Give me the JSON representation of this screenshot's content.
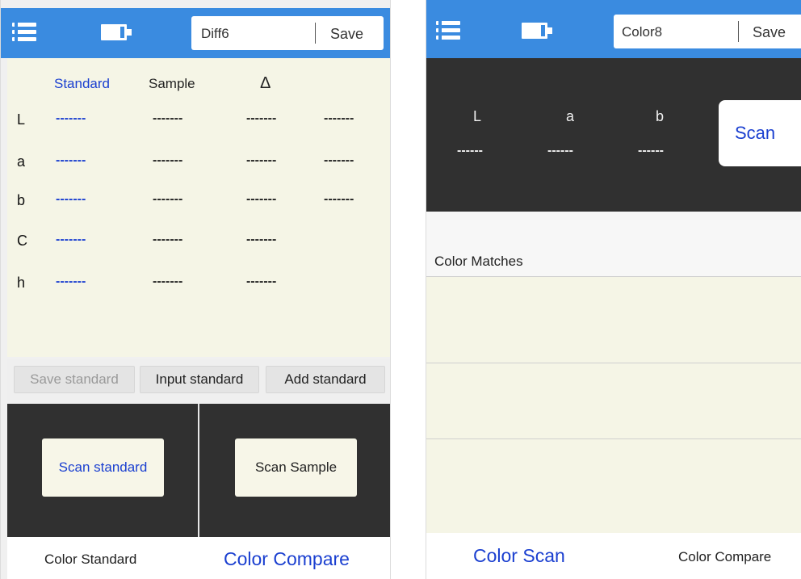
{
  "colors": {
    "header": "#3a8be0",
    "accent_blue": "#1a3fd0",
    "dark_panel": "#303030",
    "cream": "#f5f5e6"
  },
  "left_screen": {
    "header": {
      "menu_icon": "menu-icon",
      "battery_icon": "battery-icon",
      "name": "Diff6",
      "save_label": "Save"
    },
    "table": {
      "columns": [
        "Standard",
        "Sample",
        "Δ"
      ],
      "rows": [
        {
          "label": "L",
          "values": [
            "-------",
            "-------",
            "-------",
            "-------"
          ]
        },
        {
          "label": "a",
          "values": [
            "-------",
            "-------",
            "-------",
            "-------"
          ]
        },
        {
          "label": "b",
          "values": [
            "-------",
            "-------",
            "-------",
            "-------"
          ]
        },
        {
          "label": "C",
          "values": [
            "-------",
            "-------",
            "-------"
          ]
        },
        {
          "label": "h",
          "values": [
            "-------",
            "-------",
            "-------"
          ]
        }
      ]
    },
    "buttons": {
      "save_standard": "Save standard",
      "input_standard": "Input standard",
      "add_standard": "Add standard"
    },
    "scan": {
      "scan_standard": "Scan standard",
      "scan_sample": "Scan Sample"
    },
    "tabs": {
      "color_standard": "Color Standard",
      "color_compare": "Color Compare"
    }
  },
  "right_screen": {
    "header": {
      "menu_icon": "menu-icon",
      "battery_icon": "battery-icon",
      "name": "Color8",
      "save_label": "Save"
    },
    "reading": {
      "labels": [
        "L",
        "a",
        "b"
      ],
      "values": [
        "------",
        "------",
        "------"
      ],
      "scan_label": "Scan"
    },
    "matches_title": "Color Matches",
    "tabs": {
      "color_scan": "Color Scan",
      "color_compare": "Color Compare"
    }
  }
}
